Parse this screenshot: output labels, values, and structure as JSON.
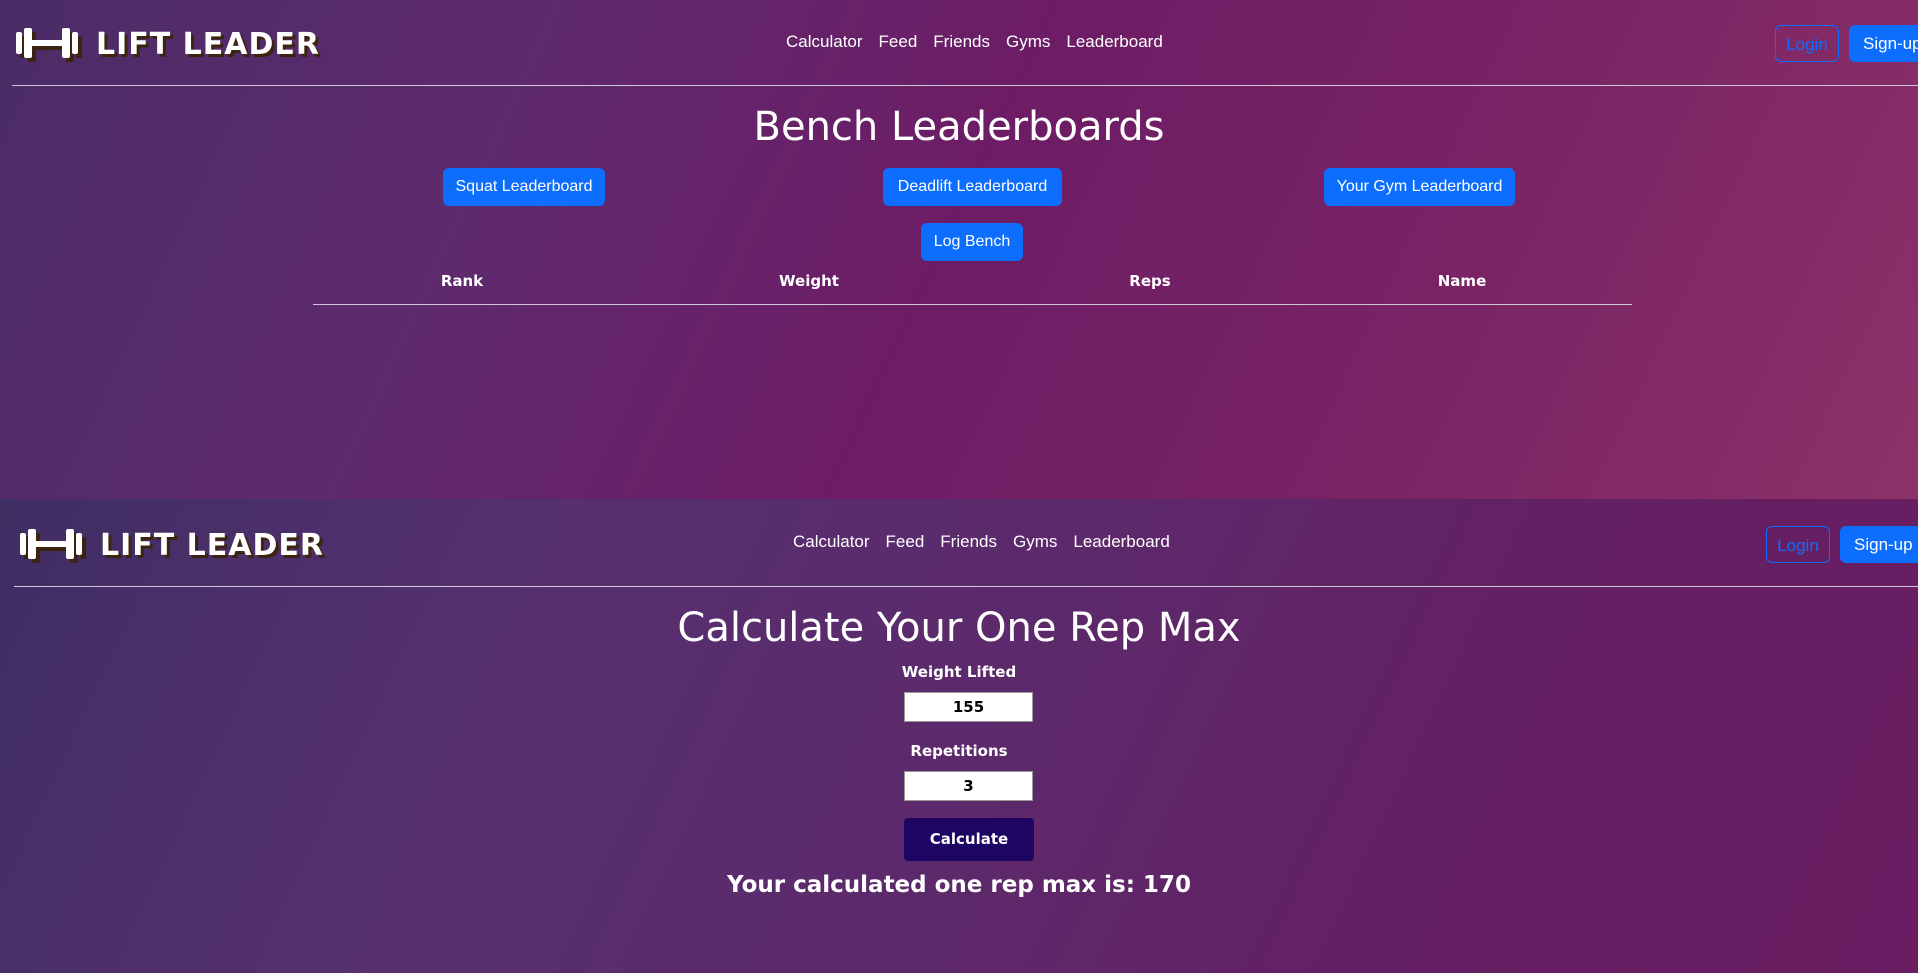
{
  "leaderboard_page": {
    "nav": {
      "logo_text": "LIFT LEADER",
      "links": [
        "Calculator",
        "Feed",
        "Friends",
        "Gyms",
        "Leaderboard"
      ],
      "login_label": "Login",
      "signup_label": "Sign-up"
    },
    "title": "Bench Leaderboards",
    "buttons": {
      "squat": "Squat Leaderboard",
      "deadlift": "Deadlift Leaderboard",
      "gym": "Your Gym Leaderboard",
      "log": "Log Bench"
    },
    "table": {
      "headers": [
        "Rank",
        "Weight",
        "Reps",
        "Name"
      ],
      "rows": []
    }
  },
  "calculator_page": {
    "nav": {
      "logo_text": "LIFT LEADER",
      "links": [
        "Calculator",
        "Feed",
        "Friends",
        "Gyms",
        "Leaderboard"
      ],
      "login_label": "Login",
      "signup_label": "Sign-up"
    },
    "title": "Calculate Your One Rep Max",
    "weight_label": "Weight Lifted",
    "weight_value": "155",
    "reps_label": "Repetitions",
    "reps_value": "3",
    "calculate_label": "Calculate",
    "result_text": "Your calculated one rep max is: 170"
  },
  "colors": {
    "primary_button": "#0d6efd",
    "calculate_button": "#1e0563",
    "logo_shadow": "#3b2410"
  },
  "icons": {
    "logo": "dumbbell-icon"
  }
}
